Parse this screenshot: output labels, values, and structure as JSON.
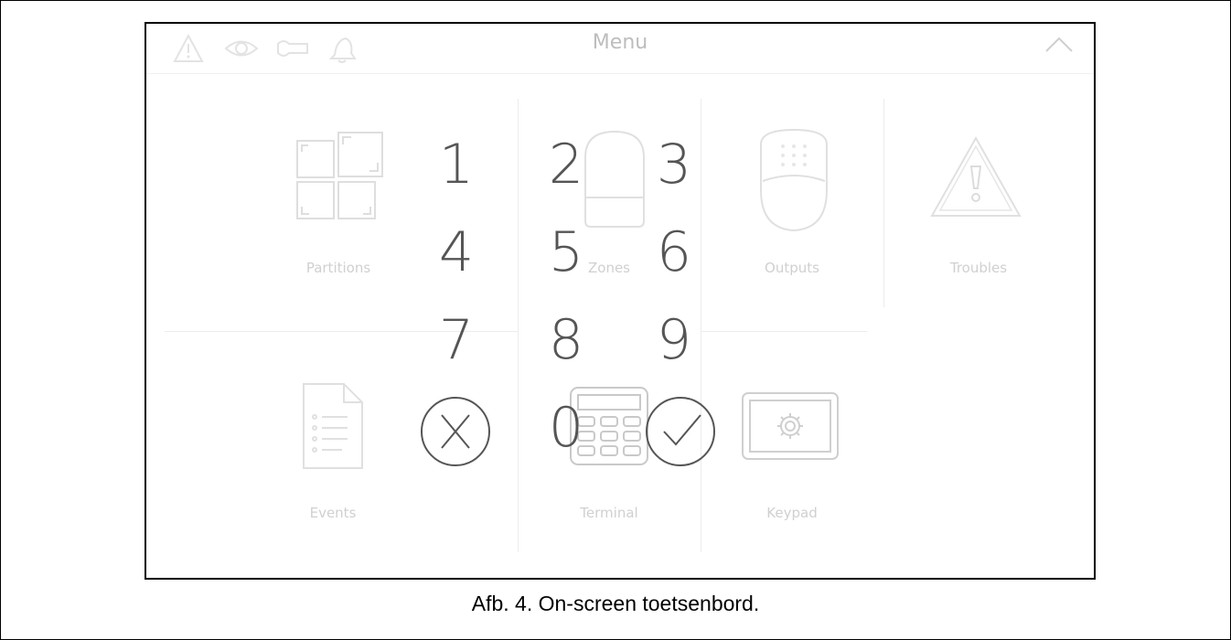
{
  "header": {
    "title": "Menu"
  },
  "menu_tiles": [
    {
      "label": "Partitions",
      "icon": "partitions-icon"
    },
    {
      "label": "Zones",
      "icon": "zones-icon"
    },
    {
      "label": "Outputs",
      "icon": "outputs-icon"
    },
    {
      "label": "Troubles",
      "icon": "troubles-icon"
    },
    {
      "label": "Events",
      "icon": "events-icon"
    },
    {
      "label": "Terminal",
      "icon": "terminal-icon"
    },
    {
      "label": "Keypad",
      "icon": "keypad-icon"
    }
  ],
  "keypad": {
    "keys": [
      "1",
      "2",
      "3",
      "4",
      "5",
      "6",
      "7",
      "8",
      "9",
      "0"
    ],
    "cancel_icon": "cancel-x-icon",
    "confirm_icon": "confirm-check-icon"
  },
  "caption": "Afb. 4. On-screen toetsenbord."
}
